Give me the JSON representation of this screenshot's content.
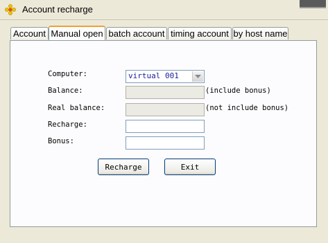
{
  "window": {
    "title": "Account recharge"
  },
  "tabs": [
    {
      "label": "Account"
    },
    {
      "label": "Manual open"
    },
    {
      "label": "batch account"
    },
    {
      "label": "timing account"
    },
    {
      "label": "by host name"
    }
  ],
  "active_tab": "Manual open",
  "form": {
    "computer_label": "Computer:",
    "computer_value": "virtual 001",
    "balance_label": "Balance:",
    "balance_value": "",
    "balance_note": "(include bonus)",
    "real_balance_label": "Real balance:",
    "real_balance_value": "",
    "real_balance_note": "(not include bonus)",
    "recharge_label": "Recharge:",
    "recharge_value": "",
    "bonus_label": "Bonus:",
    "bonus_value": ""
  },
  "buttons": {
    "recharge": "Recharge",
    "exit": "Exit"
  },
  "icons": {
    "app": "gear-flower-icon",
    "dropdown": "chevron-down-icon"
  },
  "colors": {
    "window_bg": "#ece9d8",
    "panel_bg": "#fcfcfe",
    "active_tab_accent": "#f0a030",
    "select_text": "#1a1aa0",
    "button_border": "#003c74"
  }
}
